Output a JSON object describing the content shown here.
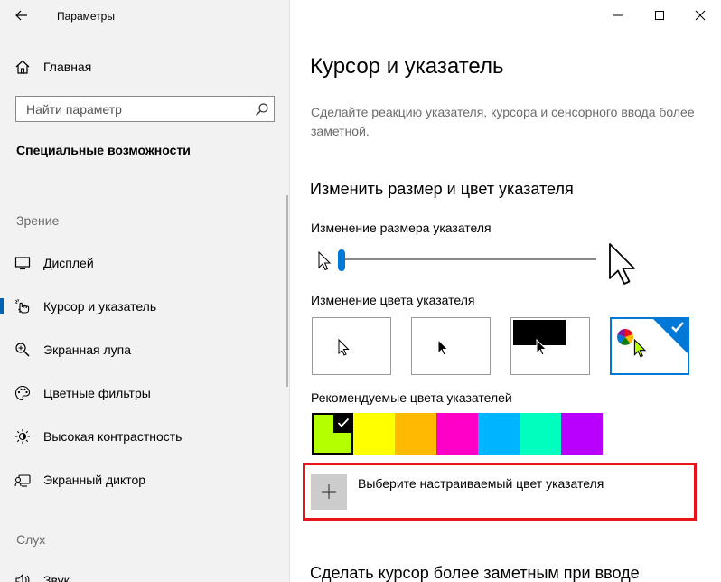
{
  "window": {
    "title": "Параметры",
    "controls": {
      "minimize": "minimize-icon",
      "maximize": "maximize-icon",
      "close": "close-icon"
    }
  },
  "sidebar": {
    "home_label": "Главная",
    "search_placeholder": "Найти параметр",
    "section_title": "Специальные возможности",
    "group_vision": "Зрение",
    "items": [
      {
        "label": "Дисплей",
        "icon": "monitor-icon"
      },
      {
        "label": "Курсор и указатель",
        "icon": "pointer-icon",
        "selected": true
      },
      {
        "label": "Экранная лупа",
        "icon": "magnifier-icon"
      },
      {
        "label": "Цветные фильтры",
        "icon": "palette-icon"
      },
      {
        "label": "Высокая контрастность",
        "icon": "sun-icon"
      },
      {
        "label": "Экранный диктор",
        "icon": "narrator-icon"
      }
    ],
    "group_hearing": "Слух",
    "partial_item_label": "Звук"
  },
  "main": {
    "title": "Курсор и указатель",
    "description": "Сделайте реакцию указателя, курсора и сенсорного ввода более заметной.",
    "section_size_color": "Изменить размер и цвет указателя",
    "size_label": "Изменение размера указателя",
    "size_value": 1,
    "size_min": 1,
    "size_max": 15,
    "color_label": "Изменение цвета указателя",
    "pointer_styles": [
      {
        "name": "white",
        "selected": false
      },
      {
        "name": "black",
        "selected": false
      },
      {
        "name": "inverted",
        "selected": false
      },
      {
        "name": "custom",
        "selected": true
      }
    ],
    "recommended_label": "Рекомендуемые цвета указателей",
    "recommended_colors": [
      "#b4ff00",
      "#ffff00",
      "#ffb900",
      "#ff00c8",
      "#00b4ff",
      "#00ffbe",
      "#b900ff"
    ],
    "recommended_selected_index": 0,
    "custom_color_label": "Выберите настраиваемый цвет указателя",
    "bottom_section": "Сделать курсор более заметным при вводе"
  },
  "colors": {
    "accent": "#0078d7",
    "highlight": "#e8141c",
    "sidebar_bg": "#f2f2f2"
  }
}
